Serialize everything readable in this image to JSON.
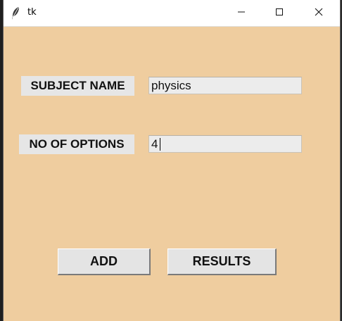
{
  "window": {
    "title": "tk",
    "background_color": "#efcd9f",
    "controls": [
      "minimize-icon",
      "maximize-icon",
      "close-icon"
    ]
  },
  "form": {
    "subject_label": "SUBJECT NAME",
    "subject_value": "physics",
    "options_label": "NO OF OPTIONS",
    "options_value": "4"
  },
  "buttons": {
    "add_label": "ADD",
    "results_label": "RESULTS"
  }
}
